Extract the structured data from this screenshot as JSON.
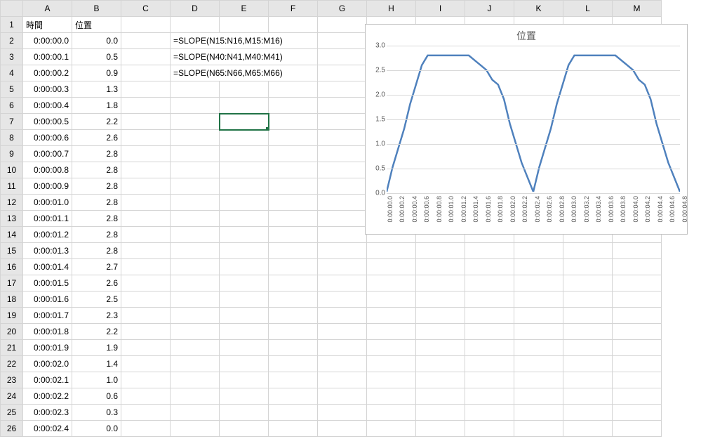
{
  "columns": [
    "A",
    "B",
    "C",
    "D",
    "E",
    "F",
    "G",
    "H",
    "I",
    "J",
    "K",
    "L",
    "M"
  ],
  "headers": {
    "A": "時間",
    "B": "位置"
  },
  "rows": [
    {
      "n": 1
    },
    {
      "n": 2,
      "A": "0:00:00.0",
      "B": "0.0",
      "D_span": "=SLOPE(N15:N16,M15:M16)"
    },
    {
      "n": 3,
      "A": "0:00:00.1",
      "B": "0.5",
      "D_span": "=SLOPE(N40:N41,M40:M41)"
    },
    {
      "n": 4,
      "A": "0:00:00.2",
      "B": "0.9",
      "D_span": "=SLOPE(N65:N66,M65:M66)"
    },
    {
      "n": 5,
      "A": "0:00:00.3",
      "B": "1.3"
    },
    {
      "n": 6,
      "A": "0:00:00.4",
      "B": "1.8"
    },
    {
      "n": 7,
      "A": "0:00:00.5",
      "B": "2.2"
    },
    {
      "n": 8,
      "A": "0:00:00.6",
      "B": "2.6"
    },
    {
      "n": 9,
      "A": "0:00:00.7",
      "B": "2.8"
    },
    {
      "n": 10,
      "A": "0:00:00.8",
      "B": "2.8"
    },
    {
      "n": 11,
      "A": "0:00:00.9",
      "B": "2.8"
    },
    {
      "n": 12,
      "A": "0:00:01.0",
      "B": "2.8"
    },
    {
      "n": 13,
      "A": "0:00:01.1",
      "B": "2.8"
    },
    {
      "n": 14,
      "A": "0:00:01.2",
      "B": "2.8"
    },
    {
      "n": 15,
      "A": "0:00:01.3",
      "B": "2.8"
    },
    {
      "n": 16,
      "A": "0:00:01.4",
      "B": "2.7"
    },
    {
      "n": 17,
      "A": "0:00:01.5",
      "B": "2.6"
    },
    {
      "n": 18,
      "A": "0:00:01.6",
      "B": "2.5"
    },
    {
      "n": 19,
      "A": "0:00:01.7",
      "B": "2.3"
    },
    {
      "n": 20,
      "A": "0:00:01.8",
      "B": "2.2"
    },
    {
      "n": 21,
      "A": "0:00:01.9",
      "B": "1.9"
    },
    {
      "n": 22,
      "A": "0:00:02.0",
      "B": "1.4"
    },
    {
      "n": 23,
      "A": "0:00:02.1",
      "B": "1.0"
    },
    {
      "n": 24,
      "A": "0:00:02.2",
      "B": "0.6"
    },
    {
      "n": 25,
      "A": "0:00:02.3",
      "B": "0.3"
    },
    {
      "n": 26,
      "A": "0:00:02.4",
      "B": "0.0"
    }
  ],
  "selected_cell": "E7",
  "chart_data": {
    "type": "line",
    "title": "位置",
    "ylim": [
      0,
      3.0
    ],
    "yticks": [
      0.0,
      0.5,
      1.0,
      1.5,
      2.0,
      2.5,
      3.0
    ],
    "xticks": [
      "0:00:00.0",
      "0:00:00.2",
      "0:00:00.4",
      "0:00:00.6",
      "0:00:00.8",
      "0:00:01.0",
      "0:00:01.2",
      "0:00:01.4",
      "0:00:01.6",
      "0:00:01.8",
      "0:00:02.0",
      "0:00:02.2",
      "0:00:02.4",
      "0:00:02.6",
      "0:00:02.8",
      "0:00:03.0",
      "0:00:03.2",
      "0:00:03.4",
      "0:00:03.6",
      "0:00:03.8",
      "0:00:04.0",
      "0:00:04.2",
      "0:00:04.4",
      "0:00:04.6",
      "0:00:04.8"
    ],
    "series": [
      {
        "name": "位置",
        "color": "#4f81bd",
        "values": [
          0.0,
          0.5,
          0.9,
          1.3,
          1.8,
          2.2,
          2.6,
          2.8,
          2.8,
          2.8,
          2.8,
          2.8,
          2.8,
          2.8,
          2.8,
          2.7,
          2.6,
          2.5,
          2.3,
          2.2,
          1.9,
          1.4,
          1.0,
          0.6,
          0.3,
          0.0,
          0.5,
          0.9,
          1.3,
          1.8,
          2.2,
          2.6,
          2.8,
          2.8,
          2.8,
          2.8,
          2.8,
          2.8,
          2.8,
          2.8,
          2.7,
          2.6,
          2.5,
          2.3,
          2.2,
          1.9,
          1.4,
          1.0,
          0.6,
          0.3,
          0.0
        ]
      }
    ]
  }
}
